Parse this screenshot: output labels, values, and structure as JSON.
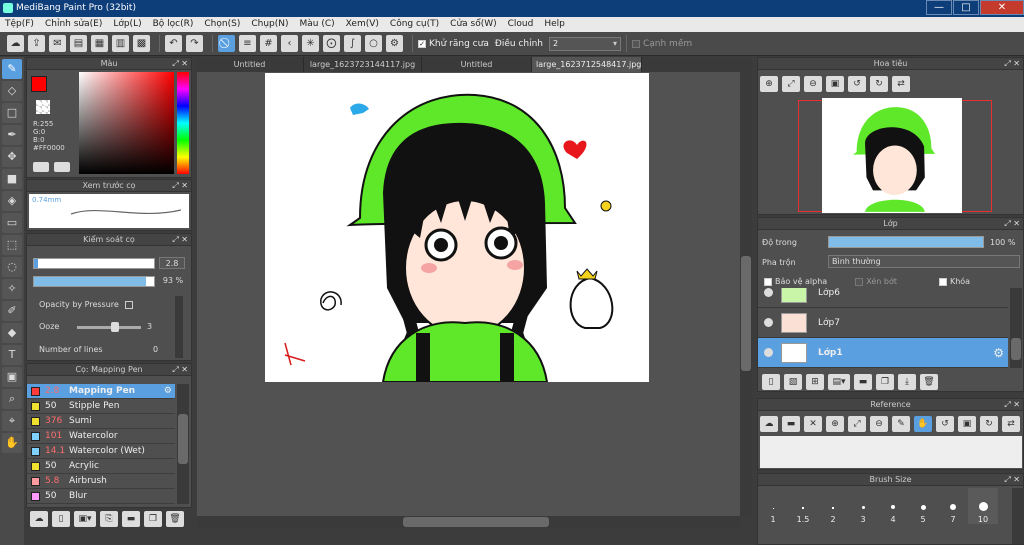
{
  "window": {
    "title": "MediBang Paint Pro (32bit)",
    "minimize": "—",
    "maximize": "□",
    "close": "✕"
  },
  "menu": [
    "Tệp(F)",
    "Chỉnh sửa(E)",
    "Lớp(L)",
    "Bộ lọc(R)",
    "Chọn(S)",
    "Chụp(N)",
    "Màu (C)",
    "Xem(V)",
    "Công cụ(T)",
    "Cửa sổ(W)",
    "Cloud",
    "Help"
  ],
  "toolbar": {
    "antialias_label": "Khử răng cưa",
    "adjust_label": "Điều chỉnh",
    "adjust_value": "2",
    "edge_label": "Cạnh mềm"
  },
  "tabs": [
    "Untitled",
    "large_1623723144117.jpg",
    "Untitled",
    "large_1623712548417.jpg"
  ],
  "color_panel": {
    "title": "Màu",
    "r": "R:255",
    "g": "G:0",
    "b": "B:0",
    "hex": "#FF0000",
    "primary": "#ff0000",
    "secondary": "#ffcccc"
  },
  "preview_panel": {
    "title": "Xem trước cọ",
    "size": "0.74mm"
  },
  "control_panel": {
    "title": "Kiểm soát cọ",
    "size_value": "2.8",
    "opacity_value": "93 %",
    "opacity_pressure": "Opacity by Pressure",
    "ooze_label": "Ooze",
    "ooze_value": "3",
    "lines_label": "Number of lines",
    "lines_value": "0"
  },
  "brush_panel": {
    "title": "Cọ: Mapping Pen",
    "brushes": [
      {
        "size": "2.8",
        "name": "Mapping Pen",
        "color": "#ff3b3b"
      },
      {
        "size": "50",
        "name": "Stipple Pen",
        "color": "#f0e030"
      },
      {
        "size": "376",
        "name": "Sumi",
        "color": "#f0e030"
      },
      {
        "size": "101",
        "name": "Watercolor",
        "color": "#7fd0ff"
      },
      {
        "size": "14.1",
        "name": "Watercolor (Wet)",
        "color": "#7fd0ff"
      },
      {
        "size": "50",
        "name": "Acrylic",
        "color": "#f0e030"
      },
      {
        "size": "5.8",
        "name": "Airbrush",
        "color": "#ff9aa0"
      },
      {
        "size": "50",
        "name": "Blur",
        "color": "#ff9aff"
      }
    ]
  },
  "navigator": {
    "title": "Hoa tiêu"
  },
  "layer_panel": {
    "title": "Lớp",
    "opacity_label": "Độ trong",
    "opacity_value": "100 %",
    "blend_label": "Pha trộn",
    "blend_value": "Bình thường",
    "protect_alpha": "Bảo vệ alpha",
    "clipping": "Xén bớt",
    "lock": "Khóa",
    "layers": [
      "Lớp6",
      "Lớp7",
      "Lớp1"
    ]
  },
  "reference_panel": {
    "title": "Reference"
  },
  "brush_size_panel": {
    "title": "Brush Size",
    "sizes": [
      "1",
      "1.5",
      "2",
      "3",
      "4",
      "5",
      "7",
      "10"
    ]
  }
}
